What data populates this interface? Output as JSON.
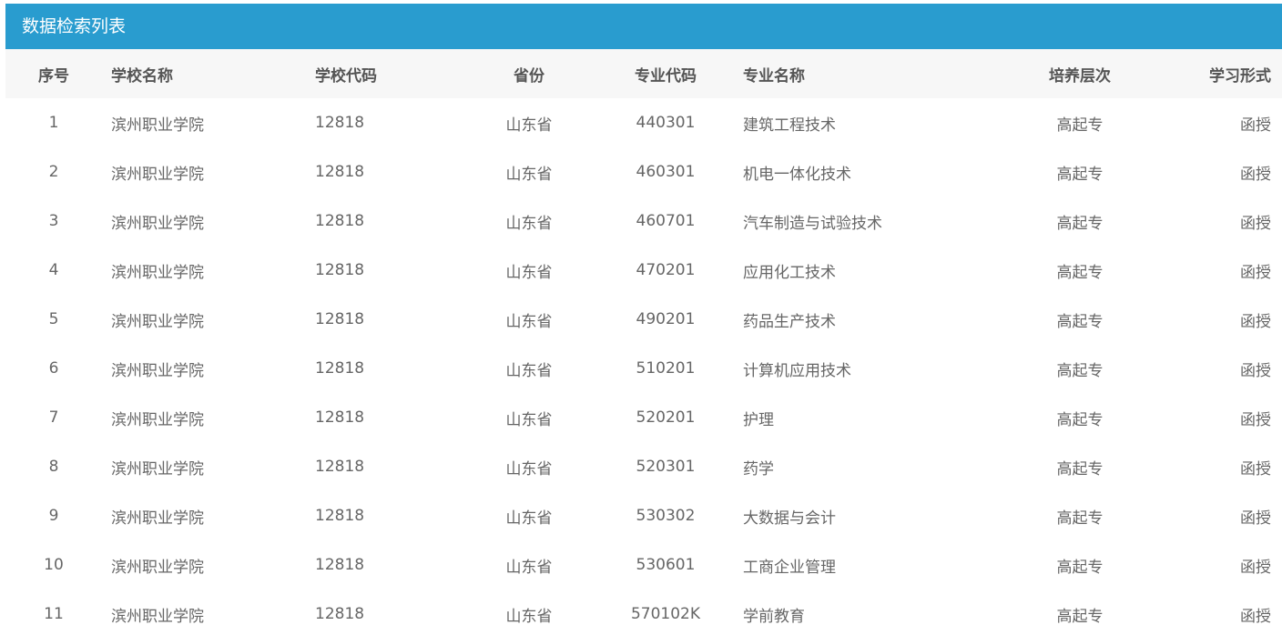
{
  "panel": {
    "title": "数据检索列表",
    "accent_color": "#299ccf"
  },
  "table": {
    "columns": [
      "序号",
      "学校名称",
      "学校代码",
      "省份",
      "专业代码",
      "专业名称",
      "培养层次",
      "学习形式"
    ],
    "rows": [
      [
        "1",
        "滨州职业学院",
        "12818",
        "山东省",
        "440301",
        "建筑工程技术",
        "高起专",
        "函授"
      ],
      [
        "2",
        "滨州职业学院",
        "12818",
        "山东省",
        "460301",
        "机电一体化技术",
        "高起专",
        "函授"
      ],
      [
        "3",
        "滨州职业学院",
        "12818",
        "山东省",
        "460701",
        "汽车制造与试验技术",
        "高起专",
        "函授"
      ],
      [
        "4",
        "滨州职业学院",
        "12818",
        "山东省",
        "470201",
        "应用化工技术",
        "高起专",
        "函授"
      ],
      [
        "5",
        "滨州职业学院",
        "12818",
        "山东省",
        "490201",
        "药品生产技术",
        "高起专",
        "函授"
      ],
      [
        "6",
        "滨州职业学院",
        "12818",
        "山东省",
        "510201",
        "计算机应用技术",
        "高起专",
        "函授"
      ],
      [
        "7",
        "滨州职业学院",
        "12818",
        "山东省",
        "520201",
        "护理",
        "高起专",
        "函授"
      ],
      [
        "8",
        "滨州职业学院",
        "12818",
        "山东省",
        "520301",
        "药学",
        "高起专",
        "函授"
      ],
      [
        "9",
        "滨州职业学院",
        "12818",
        "山东省",
        "530302",
        "大数据与会计",
        "高起专",
        "函授"
      ],
      [
        "10",
        "滨州职业学院",
        "12818",
        "山东省",
        "530601",
        "工商企业管理",
        "高起专",
        "函授"
      ],
      [
        "11",
        "滨州职业学院",
        "12818",
        "山东省",
        "570102K",
        "学前教育",
        "高起专",
        "函授"
      ]
    ]
  }
}
